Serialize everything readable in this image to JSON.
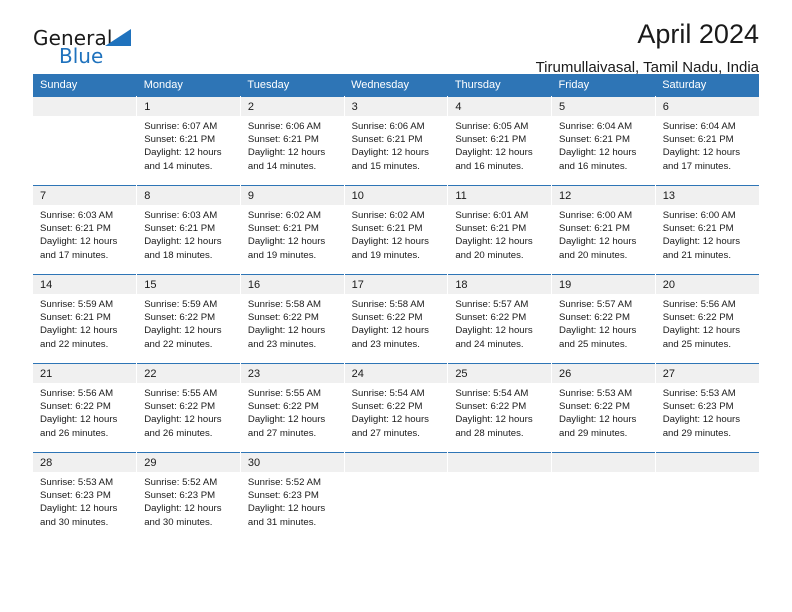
{
  "brand": {
    "name_part1": "General",
    "name_part2": "Blue",
    "triangle_color": "#1f72bd"
  },
  "header": {
    "title": "April 2024",
    "subtitle": "Tirumullaivasal, Tamil Nadu, India"
  },
  "theme": {
    "header_blue": "#2e75b6",
    "daynum_gray": "#f0f0f0",
    "text": "#1a1a1a"
  },
  "weekday_headers": [
    "Sunday",
    "Monday",
    "Tuesday",
    "Wednesday",
    "Thursday",
    "Friday",
    "Saturday"
  ],
  "weeks": [
    [
      {
        "day": "",
        "lines": []
      },
      {
        "day": "1",
        "lines": [
          "Sunrise: 6:07 AM",
          "Sunset: 6:21 PM",
          "Daylight: 12 hours",
          "and 14 minutes."
        ]
      },
      {
        "day": "2",
        "lines": [
          "Sunrise: 6:06 AM",
          "Sunset: 6:21 PM",
          "Daylight: 12 hours",
          "and 14 minutes."
        ]
      },
      {
        "day": "3",
        "lines": [
          "Sunrise: 6:06 AM",
          "Sunset: 6:21 PM",
          "Daylight: 12 hours",
          "and 15 minutes."
        ]
      },
      {
        "day": "4",
        "lines": [
          "Sunrise: 6:05 AM",
          "Sunset: 6:21 PM",
          "Daylight: 12 hours",
          "and 16 minutes."
        ]
      },
      {
        "day": "5",
        "lines": [
          "Sunrise: 6:04 AM",
          "Sunset: 6:21 PM",
          "Daylight: 12 hours",
          "and 16 minutes."
        ]
      },
      {
        "day": "6",
        "lines": [
          "Sunrise: 6:04 AM",
          "Sunset: 6:21 PM",
          "Daylight: 12 hours",
          "and 17 minutes."
        ]
      }
    ],
    [
      {
        "day": "7",
        "lines": [
          "Sunrise: 6:03 AM",
          "Sunset: 6:21 PM",
          "Daylight: 12 hours",
          "and 17 minutes."
        ]
      },
      {
        "day": "8",
        "lines": [
          "Sunrise: 6:03 AM",
          "Sunset: 6:21 PM",
          "Daylight: 12 hours",
          "and 18 minutes."
        ]
      },
      {
        "day": "9",
        "lines": [
          "Sunrise: 6:02 AM",
          "Sunset: 6:21 PM",
          "Daylight: 12 hours",
          "and 19 minutes."
        ]
      },
      {
        "day": "10",
        "lines": [
          "Sunrise: 6:02 AM",
          "Sunset: 6:21 PM",
          "Daylight: 12 hours",
          "and 19 minutes."
        ]
      },
      {
        "day": "11",
        "lines": [
          "Sunrise: 6:01 AM",
          "Sunset: 6:21 PM",
          "Daylight: 12 hours",
          "and 20 minutes."
        ]
      },
      {
        "day": "12",
        "lines": [
          "Sunrise: 6:00 AM",
          "Sunset: 6:21 PM",
          "Daylight: 12 hours",
          "and 20 minutes."
        ]
      },
      {
        "day": "13",
        "lines": [
          "Sunrise: 6:00 AM",
          "Sunset: 6:21 PM",
          "Daylight: 12 hours",
          "and 21 minutes."
        ]
      }
    ],
    [
      {
        "day": "14",
        "lines": [
          "Sunrise: 5:59 AM",
          "Sunset: 6:21 PM",
          "Daylight: 12 hours",
          "and 22 minutes."
        ]
      },
      {
        "day": "15",
        "lines": [
          "Sunrise: 5:59 AM",
          "Sunset: 6:22 PM",
          "Daylight: 12 hours",
          "and 22 minutes."
        ]
      },
      {
        "day": "16",
        "lines": [
          "Sunrise: 5:58 AM",
          "Sunset: 6:22 PM",
          "Daylight: 12 hours",
          "and 23 minutes."
        ]
      },
      {
        "day": "17",
        "lines": [
          "Sunrise: 5:58 AM",
          "Sunset: 6:22 PM",
          "Daylight: 12 hours",
          "and 23 minutes."
        ]
      },
      {
        "day": "18",
        "lines": [
          "Sunrise: 5:57 AM",
          "Sunset: 6:22 PM",
          "Daylight: 12 hours",
          "and 24 minutes."
        ]
      },
      {
        "day": "19",
        "lines": [
          "Sunrise: 5:57 AM",
          "Sunset: 6:22 PM",
          "Daylight: 12 hours",
          "and 25 minutes."
        ]
      },
      {
        "day": "20",
        "lines": [
          "Sunrise: 5:56 AM",
          "Sunset: 6:22 PM",
          "Daylight: 12 hours",
          "and 25 minutes."
        ]
      }
    ],
    [
      {
        "day": "21",
        "lines": [
          "Sunrise: 5:56 AM",
          "Sunset: 6:22 PM",
          "Daylight: 12 hours",
          "and 26 minutes."
        ]
      },
      {
        "day": "22",
        "lines": [
          "Sunrise: 5:55 AM",
          "Sunset: 6:22 PM",
          "Daylight: 12 hours",
          "and 26 minutes."
        ]
      },
      {
        "day": "23",
        "lines": [
          "Sunrise: 5:55 AM",
          "Sunset: 6:22 PM",
          "Daylight: 12 hours",
          "and 27 minutes."
        ]
      },
      {
        "day": "24",
        "lines": [
          "Sunrise: 5:54 AM",
          "Sunset: 6:22 PM",
          "Daylight: 12 hours",
          "and 27 minutes."
        ]
      },
      {
        "day": "25",
        "lines": [
          "Sunrise: 5:54 AM",
          "Sunset: 6:22 PM",
          "Daylight: 12 hours",
          "and 28 minutes."
        ]
      },
      {
        "day": "26",
        "lines": [
          "Sunrise: 5:53 AM",
          "Sunset: 6:22 PM",
          "Daylight: 12 hours",
          "and 29 minutes."
        ]
      },
      {
        "day": "27",
        "lines": [
          "Sunrise: 5:53 AM",
          "Sunset: 6:23 PM",
          "Daylight: 12 hours",
          "and 29 minutes."
        ]
      }
    ],
    [
      {
        "day": "28",
        "lines": [
          "Sunrise: 5:53 AM",
          "Sunset: 6:23 PM",
          "Daylight: 12 hours",
          "and 30 minutes."
        ]
      },
      {
        "day": "29",
        "lines": [
          "Sunrise: 5:52 AM",
          "Sunset: 6:23 PM",
          "Daylight: 12 hours",
          "and 30 minutes."
        ]
      },
      {
        "day": "30",
        "lines": [
          "Sunrise: 5:52 AM",
          "Sunset: 6:23 PM",
          "Daylight: 12 hours",
          "and 31 minutes."
        ]
      },
      {
        "day": "",
        "lines": []
      },
      {
        "day": "",
        "lines": []
      },
      {
        "day": "",
        "lines": []
      },
      {
        "day": "",
        "lines": []
      }
    ]
  ]
}
